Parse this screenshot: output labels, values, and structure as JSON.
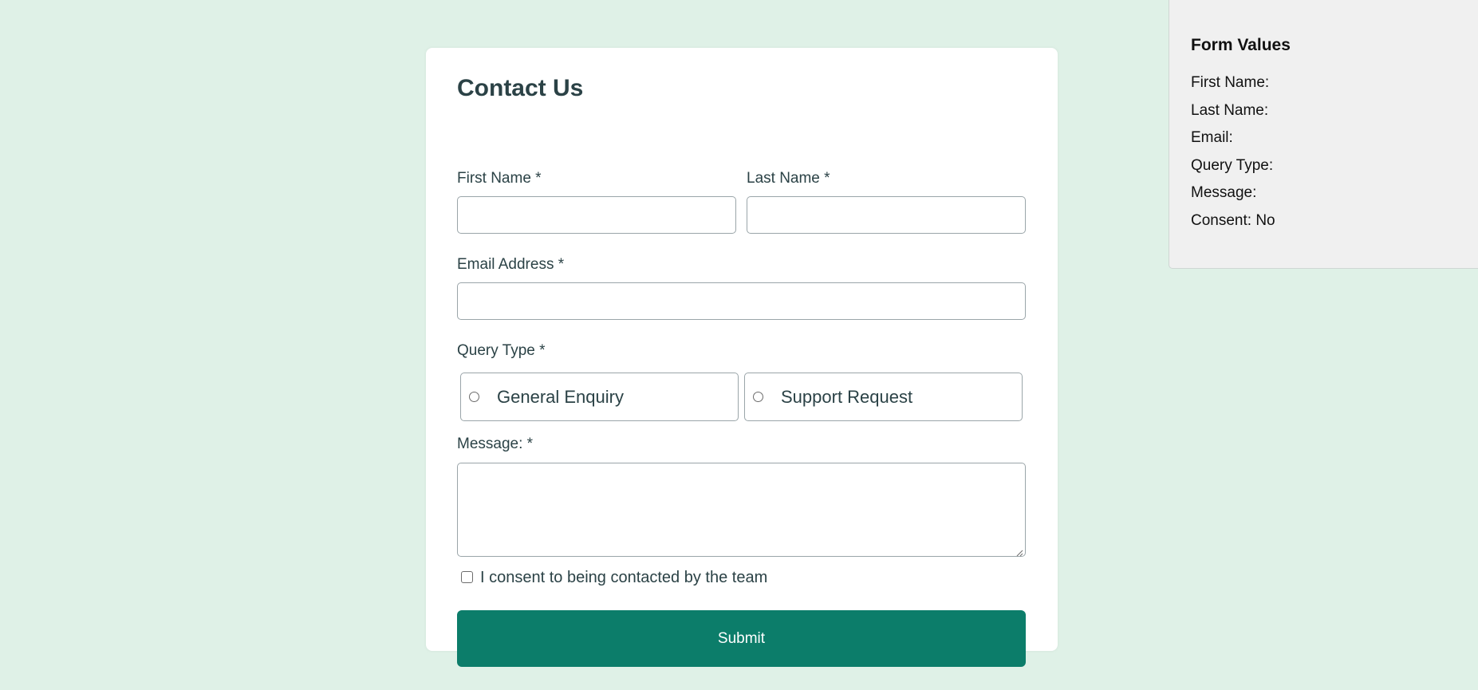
{
  "form": {
    "title": "Contact Us",
    "first_name_label": "First Name *",
    "first_name_value": "",
    "last_name_label": "Last Name *",
    "last_name_value": "",
    "email_label": "Email Address *",
    "email_value": "",
    "query_type_label": "Query Type *",
    "query_options": [
      "General Enquiry",
      "Support Request"
    ],
    "query_selected": null,
    "message_label": "Message: *",
    "message_value": "",
    "consent_label": "I consent to being contacted by the team",
    "consent_checked": false,
    "submit_label": "Submit"
  },
  "values_panel": {
    "title": "Form Values",
    "rows": [
      "First Name:",
      "Last Name:",
      "Email:",
      "Query Type:",
      "Message:",
      "Consent: No"
    ]
  },
  "colors": {
    "background": "#dff1e7",
    "accent": "#0c7d6a",
    "text": "#2b4246",
    "panel": "#f0f0f0"
  },
  "icons": {
    "resize": "resize-grip-icon"
  }
}
